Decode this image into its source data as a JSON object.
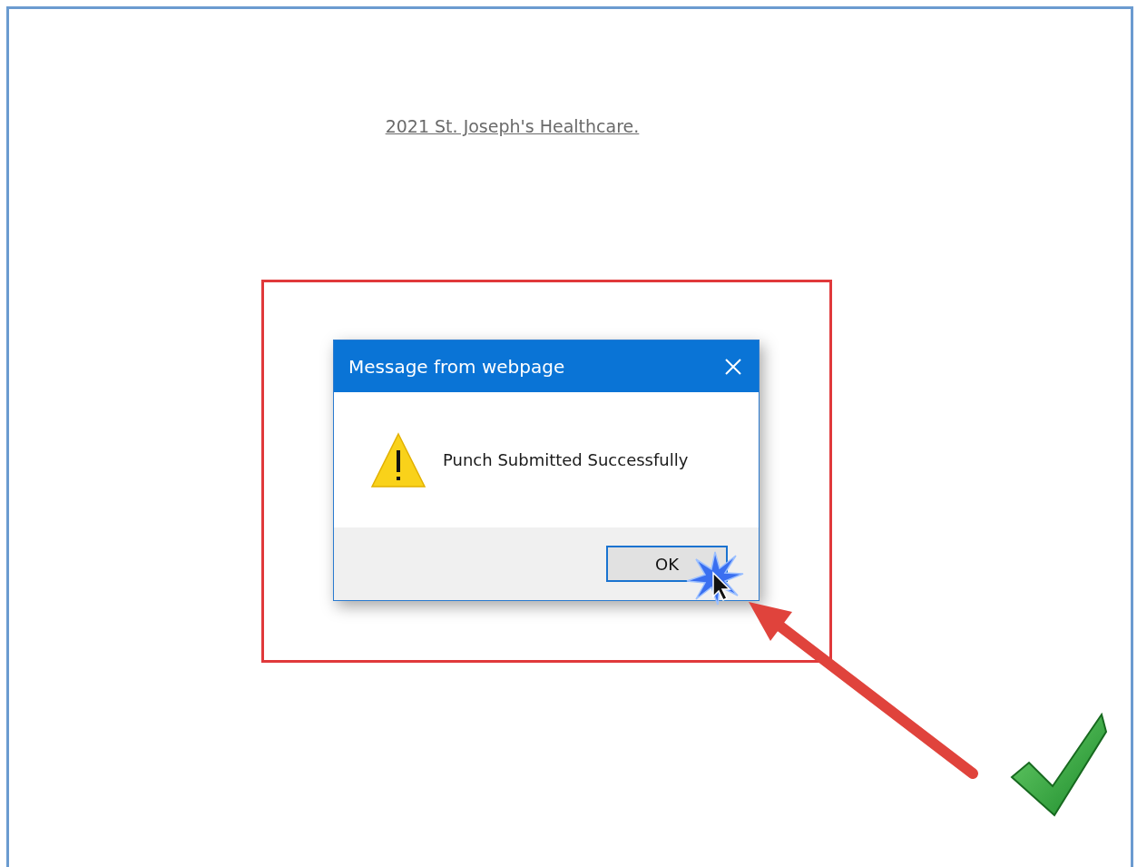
{
  "footer_link": "2021 St. Joseph's Healthcare.",
  "dialog": {
    "title": "Message from webpage",
    "message": "Punch Submitted Successfully",
    "buttons": [
      {
        "label": "OK"
      }
    ]
  }
}
